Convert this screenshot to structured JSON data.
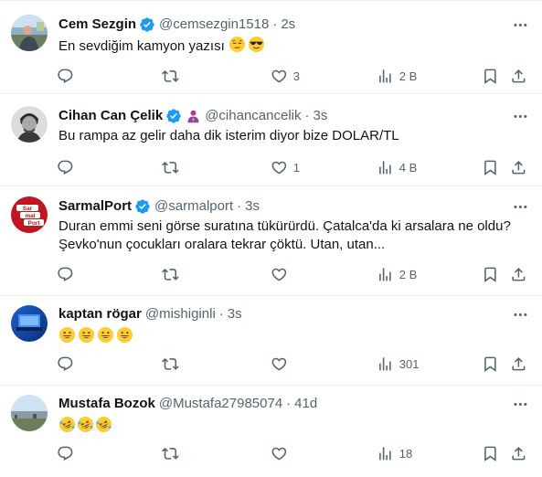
{
  "tweets": [
    {
      "name": "Cem Sezgin",
      "handle": "@cemsezgin1518",
      "time": "2s",
      "text": "En sevdiğim kamyon yazısı ",
      "emoji_icons": [
        "relieved-face-emoji",
        "sunglasses-face-emoji"
      ],
      "reply_count": "",
      "retweet_count": "",
      "like_count": "3",
      "view_count": "2 B"
    },
    {
      "name": "Cihan Can Çelik",
      "handle": "@cihancancelik",
      "time": "3s",
      "text": "Bu rampa az gelir daha dik isterim diyor bize DOLAR/TL",
      "reply_count": "",
      "retweet_count": "",
      "like_count": "1",
      "view_count": "4 B"
    },
    {
      "name": "SarmalPort",
      "handle": "@sarmalport",
      "time": "3s",
      "text_line1": "Duran emmi seni görse suratına tükürürdü. Çatalca'da ki arsalara ne oldu?",
      "text_line2": "Şevko'nun çocukları oralara tekrar çöktü. Utan, utan...",
      "avatar_text": [
        "Sar",
        "mal",
        "Port"
      ],
      "reply_count": "",
      "retweet_count": "",
      "like_count": "",
      "view_count": "2 B"
    },
    {
      "name": "kaptan rögar",
      "handle": "@mishiginli",
      "time": "3s",
      "emoji_icons": [
        "grinning-face-emoji",
        "grinning-face-emoji",
        "grinning-face-emoji",
        "grinning-face-emoji"
      ],
      "reply_count": "",
      "retweet_count": "",
      "like_count": "",
      "view_count": "301"
    },
    {
      "name": "Mustafa Bozok",
      "handle": "@Mustafa27985074",
      "time": "41d",
      "emoji_icons": [
        "rofl-emoji",
        "rofl-emoji",
        "rofl-emoji"
      ],
      "reply_count": "",
      "retweet_count": "",
      "like_count": "",
      "view_count": "18"
    }
  ],
  "separator": "·",
  "colors": {
    "text": "#0f1419",
    "secondary": "#536471",
    "verified": "#1d9bf0",
    "affiliate": "#c13584",
    "border": "#eff3f4"
  }
}
